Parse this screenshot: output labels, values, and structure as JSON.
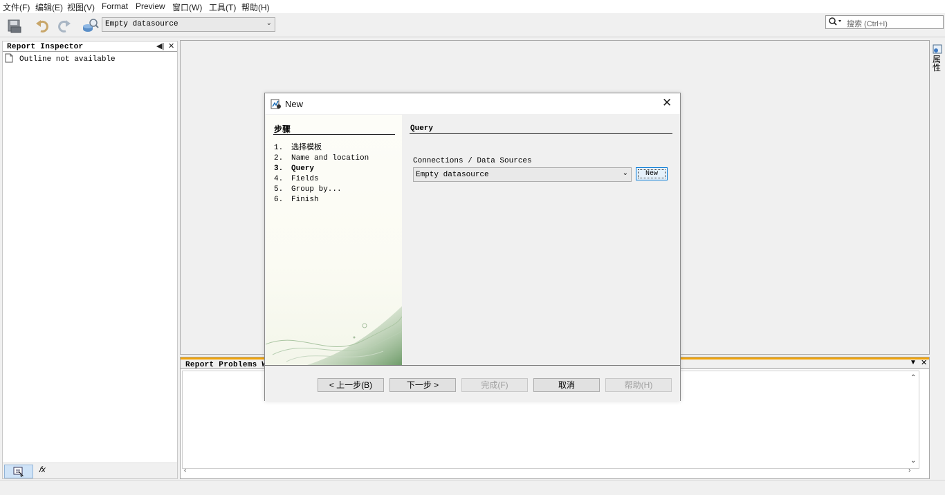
{
  "menu": [
    "文件(F)",
    "编辑(E)",
    "视图(V)",
    "Format",
    "Preview",
    "窗口(W)",
    "工具(T)",
    "帮助(H)"
  ],
  "toolbar": {
    "datasource_value": "Empty datasource",
    "search_placeholder": "搜索 (Ctrl+I)"
  },
  "inspector": {
    "title": "Report Inspector",
    "outline_text": "Outline not available"
  },
  "right_strip": {
    "label": "属性"
  },
  "problems": {
    "title": "Report Problems W"
  },
  "dialog": {
    "title": "New",
    "steps_heading": "步骤",
    "steps": [
      {
        "num": "1.",
        "label": "选择模板"
      },
      {
        "num": "2.",
        "label": "Name and location"
      },
      {
        "num": "3.",
        "label": "Query"
      },
      {
        "num": "4.",
        "label": "Fields"
      },
      {
        "num": "5.",
        "label": "Group by..."
      },
      {
        "num": "6.",
        "label": "Finish"
      }
    ],
    "current_step_index": 2,
    "panel_heading": "Query",
    "connections_label": "Connections / Data Sources",
    "connections_value": "Empty datasource",
    "new_button": "New",
    "buttons": {
      "back": "< 上一步(B)",
      "next": "下一步 >",
      "finish": "完成(F)",
      "cancel": "取消",
      "help": "帮助(H)"
    }
  },
  "colors": {
    "accent": "#0078d7",
    "problems_tab_accent": "#f0a30a"
  }
}
